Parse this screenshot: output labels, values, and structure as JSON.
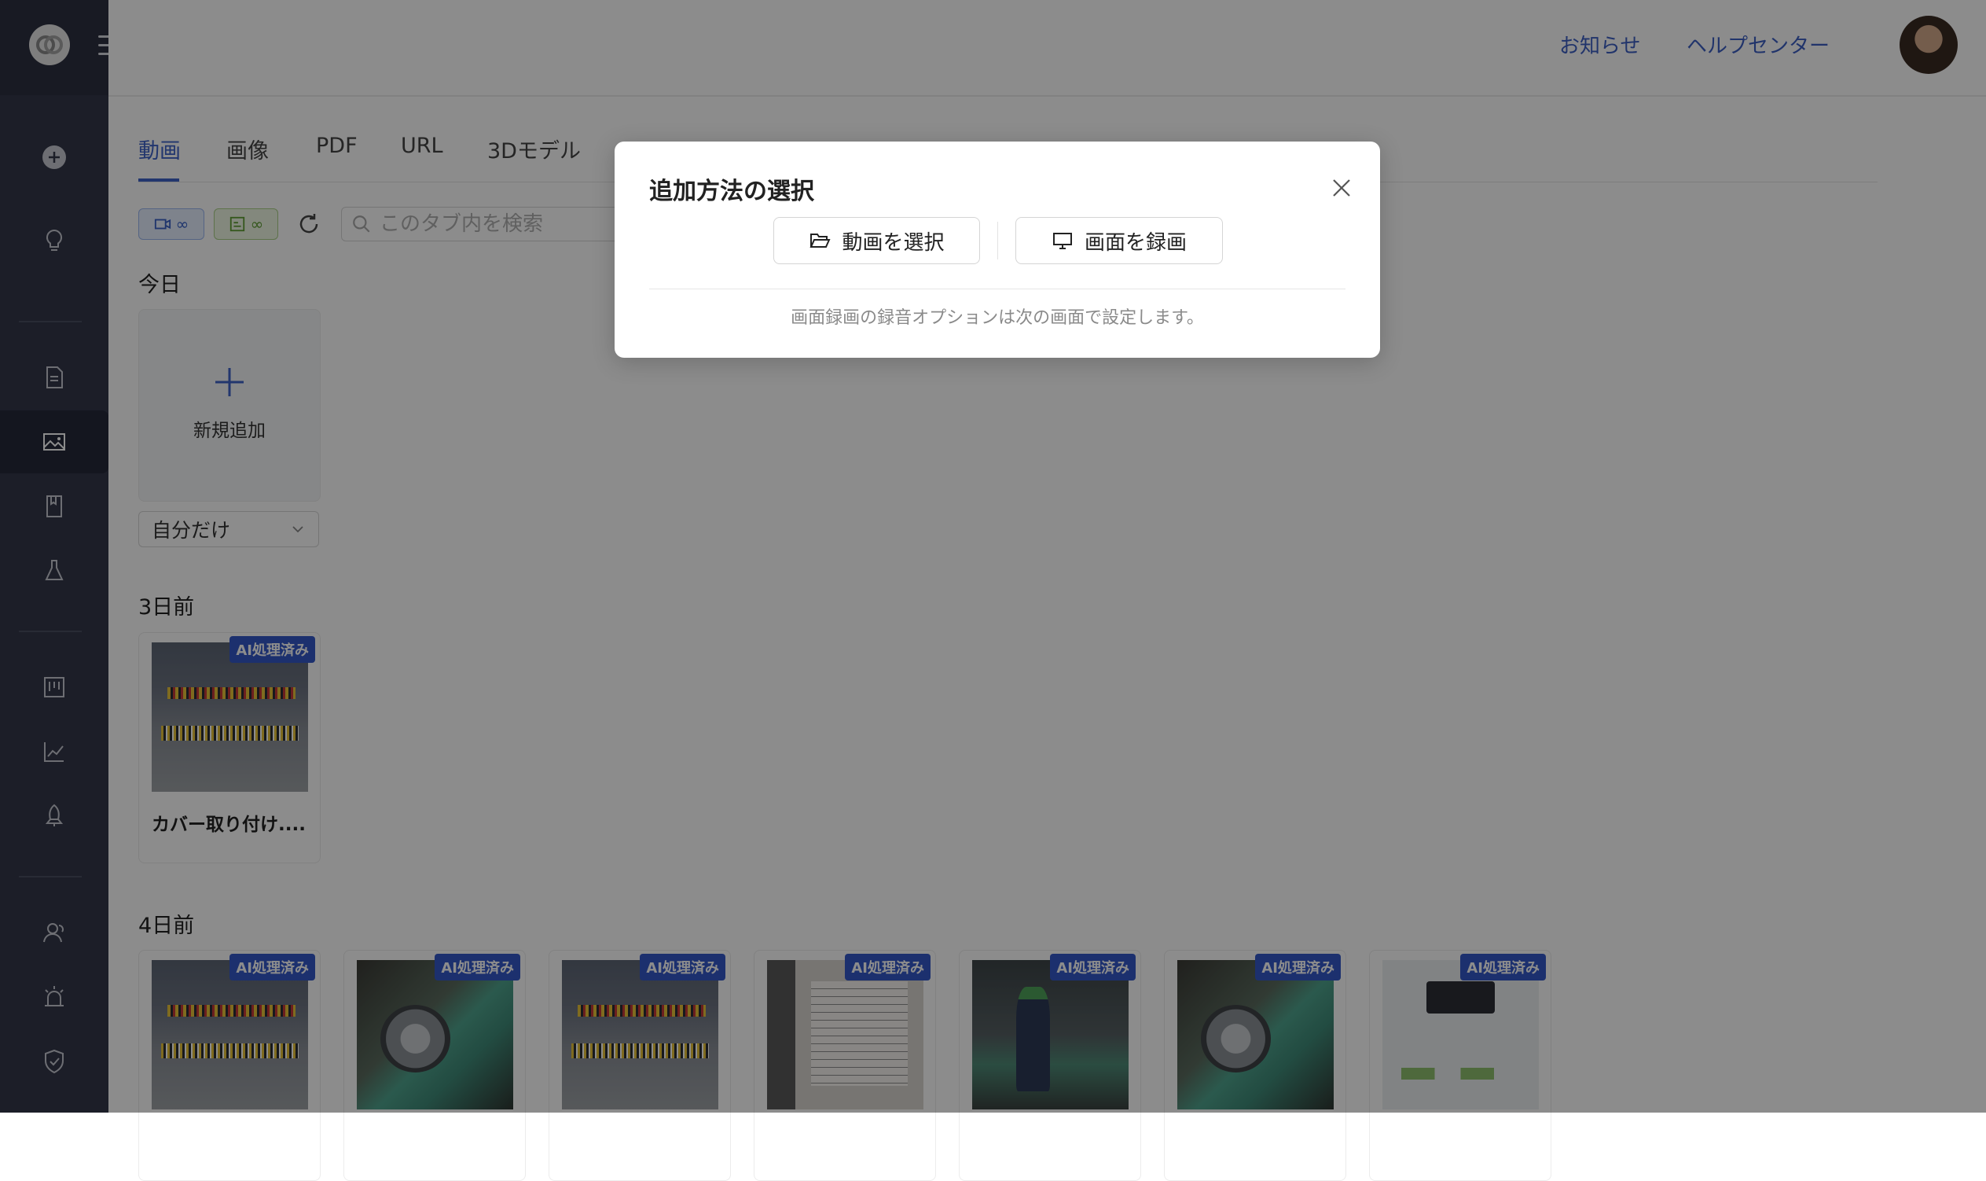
{
  "header": {
    "notifications_label": "お知らせ",
    "help_label": "ヘルプセンター"
  },
  "tabs": [
    {
      "label": "動画",
      "active": true
    },
    {
      "label": "画像",
      "active": false
    },
    {
      "label": "PDF",
      "active": false
    },
    {
      "label": "URL",
      "active": false
    },
    {
      "label": "3Dモデル",
      "active": false
    }
  ],
  "filters": {
    "video_count": "∞",
    "image_count": "∞",
    "search_placeholder": "このタブ内を検索"
  },
  "sections": {
    "today": "今日",
    "three_days": "3日前",
    "four_days": "4日前"
  },
  "new_item": {
    "label": "新規追加",
    "scope_value": "自分だけ"
  },
  "badge_label": "AI処理済み",
  "cards_3days": [
    {
      "title": "カバー取り付け....",
      "thumb": "panel"
    }
  ],
  "cards_4days": [
    {
      "thumb": "panel"
    },
    {
      "thumb": "cut"
    },
    {
      "thumb": "panel"
    },
    {
      "thumb": "doc"
    },
    {
      "thumb": "worker"
    },
    {
      "thumb": "cut"
    },
    {
      "thumb": "web"
    }
  ],
  "modal": {
    "title": "追加方法の選択",
    "select_video_label": "動画を選択",
    "record_screen_label": "画面を録画",
    "note": "画面録画の録音オプションは次の画面で設定します。"
  },
  "colors": {
    "accent": "#3f63c9",
    "sidebar": "#34384a",
    "badge": "#3458c9"
  }
}
